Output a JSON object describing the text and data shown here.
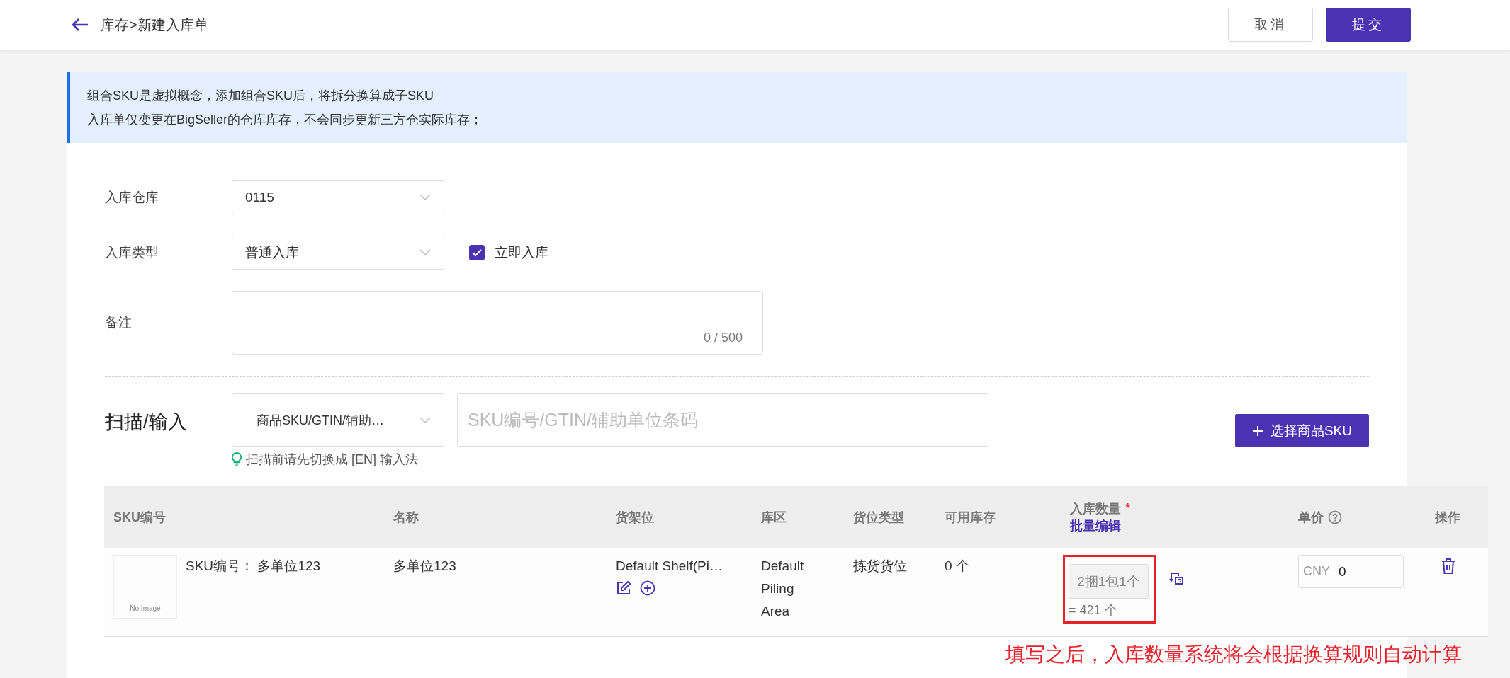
{
  "header": {
    "title": "库存>新建入库单",
    "buttons": [
      {
        "label": "取消",
        "kind": "secondary"
      },
      {
        "label": "提交",
        "kind": "primary"
      }
    ]
  },
  "notice": {
    "lines": [
      "组合SKU是虚拟概念，添加组合SKU后，将拆分换算成子SKU",
      "入库单仅变更在BigSeller的仓库库存，不会同步更新三方仓实际库存；"
    ]
  },
  "form": {
    "warehouse": {
      "label": "入库仓库",
      "value": "0115"
    },
    "type": {
      "label": "入库类型",
      "value": "普通入库"
    },
    "instant": {
      "label": "立即入库",
      "checked": true
    },
    "remark": {
      "label": "备注",
      "counter": "0 / 500"
    }
  },
  "scan": {
    "label": "扫描/输入",
    "mode": "商品SKU/GTIN/辅助…",
    "placeholder": "SKU编号/GTIN/辅助单位条码",
    "hint": "扫描前请先切换成 [EN] 输入法",
    "add_button": "选择商品SKU"
  },
  "table": {
    "columns": [
      {
        "label": "SKU编号"
      },
      {
        "label": "名称"
      },
      {
        "label": "货架位"
      },
      {
        "label": "库区"
      },
      {
        "label": "货位类型"
      },
      {
        "label": "可用库存"
      },
      {
        "label": "入库数量",
        "required_mark": "*",
        "link": "批量编辑"
      },
      {
        "label": "单价",
        "help": true
      },
      {
        "label": "操作"
      }
    ],
    "rows": [
      {
        "image_label": "No Image",
        "sku_label": "SKU编号：",
        "sku": "多单位123",
        "name": "多单位123",
        "shelf": "Default Shelf(Pi…",
        "zone": "Default Piling Area",
        "location_type": "拣货货位",
        "stock": "0 个",
        "quantity": "2捆1包1个",
        "quantity_total": "= 421 个",
        "currency": "CNY",
        "price": "0"
      }
    ]
  },
  "annotation": "填写之后，入库数量系统将会根据换算规则自动计算"
}
